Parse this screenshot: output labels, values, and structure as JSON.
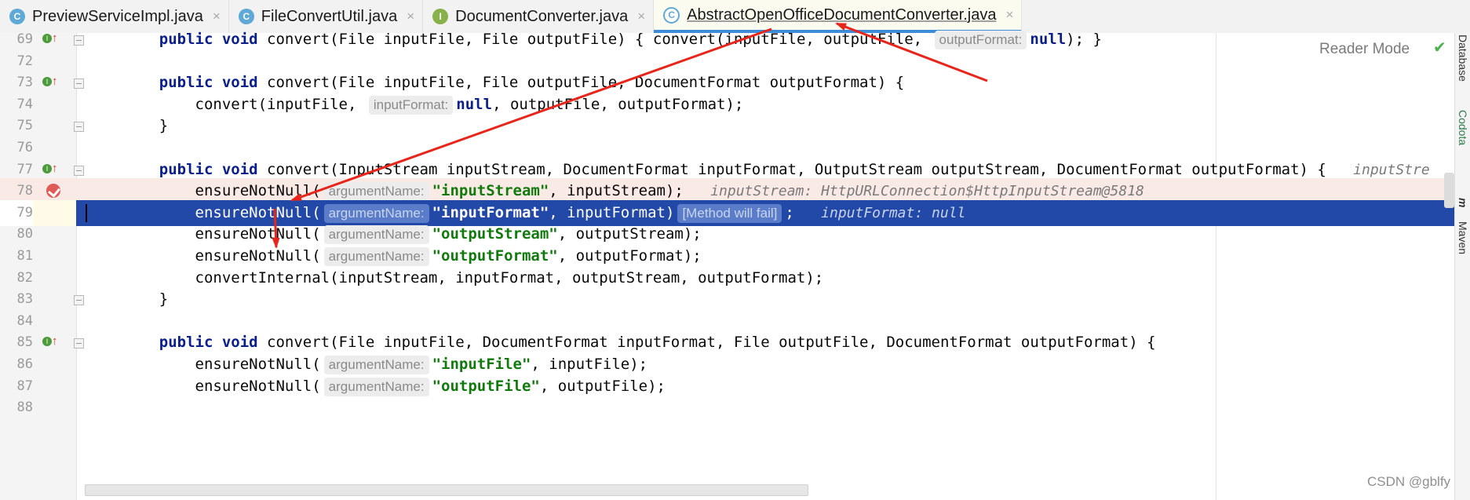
{
  "tabs": [
    {
      "icon_letter": "C",
      "icon_type": "class",
      "label": "PreviewServiceImpl.java",
      "active": false
    },
    {
      "icon_letter": "C",
      "icon_type": "class",
      "label": "FileConvertUtil.java",
      "active": false
    },
    {
      "icon_letter": "I",
      "icon_type": "interface",
      "label": "DocumentConverter.java",
      "active": false
    },
    {
      "icon_letter": "C",
      "icon_type": "abstract-class",
      "label": "AbstractOpenOfficeDocumentConverter.java",
      "active": true
    }
  ],
  "tab_close_glyph": "×",
  "reader_mode": "Reader Mode",
  "side_panels": [
    "Database",
    "Codota",
    "m",
    "Maven"
  ],
  "watermark": "CSDN @gblfy",
  "colors": {
    "arrow": "#e8251a",
    "selection": "#2248a8",
    "breakpoint": "#e05a56"
  },
  "lines": [
    {
      "n": "69",
      "marker": "impl",
      "fold": true,
      "hl": "",
      "segs": [
        [
          "    ",
          ""
        ],
        [
          "public void",
          "kw"
        ],
        [
          " convert(File inputFile, File outputFile) { convert(inputFile, outputFile, ",
          ""
        ],
        [
          "outputFormat:",
          "hint"
        ],
        [
          "null",
          "kw"
        ],
        [
          "); }",
          ""
        ]
      ]
    },
    {
      "n": "72",
      "marker": "",
      "fold": false,
      "hl": "",
      "segs": []
    },
    {
      "n": "73",
      "marker": "impl",
      "fold": true,
      "hl": "",
      "segs": [
        [
          "    ",
          ""
        ],
        [
          "public void",
          "kw"
        ],
        [
          " convert(File inputFile, File outputFile, DocumentFormat outputFormat) {",
          ""
        ]
      ]
    },
    {
      "n": "74",
      "marker": "",
      "fold": false,
      "hl": "",
      "segs": [
        [
          "        convert(inputFile, ",
          ""
        ],
        [
          "inputFormat:",
          "hint"
        ],
        [
          "null",
          "kw"
        ],
        [
          ", outputFile, outputFormat);",
          ""
        ]
      ]
    },
    {
      "n": "75",
      "marker": "",
      "fold": true,
      "hl": "",
      "segs": [
        [
          "    }",
          ""
        ]
      ]
    },
    {
      "n": "76",
      "marker": "",
      "fold": false,
      "hl": "",
      "segs": []
    },
    {
      "n": "77",
      "marker": "impl",
      "fold": true,
      "hl": "",
      "segs": [
        [
          "    ",
          ""
        ],
        [
          "public void",
          "kw"
        ],
        [
          " convert(InputStream inputStream, DocumentFormat inputFormat, OutputStream outputStream, DocumentFormat outputFormat) {   ",
          ""
        ],
        [
          "inputStre",
          "inlay"
        ]
      ]
    },
    {
      "n": "78",
      "marker": "bp",
      "fold": false,
      "hl": "pink",
      "segs": [
        [
          "        ensureNotNull(",
          ""
        ],
        [
          "argumentName:",
          "hint"
        ],
        [
          "\"inputStream\"",
          "str"
        ],
        [
          ", inputStream);   ",
          ""
        ],
        [
          "inputStream: HttpURLConnection$HttpInputStream@5818",
          "inlay"
        ]
      ]
    },
    {
      "n": "79",
      "marker": "",
      "fold": false,
      "hl": "blue",
      "segs": [
        [
          "        ensureNotNull(",
          ""
        ],
        [
          "argumentName:",
          "hint"
        ],
        [
          "\"inputFormat\"",
          "str"
        ],
        [
          ", inputFormat)",
          ""
        ],
        [
          "[Method will fail]",
          "hint"
        ],
        [
          ";   ",
          ""
        ],
        [
          "inputFormat: null",
          "inlay"
        ]
      ]
    },
    {
      "n": "80",
      "marker": "",
      "fold": false,
      "hl": "",
      "segs": [
        [
          "        ensureNotNull(",
          ""
        ],
        [
          "argumentName:",
          "hint"
        ],
        [
          "\"outputStream\"",
          "str"
        ],
        [
          ", outputStream);",
          ""
        ]
      ]
    },
    {
      "n": "81",
      "marker": "",
      "fold": false,
      "hl": "",
      "segs": [
        [
          "        ensureNotNull(",
          ""
        ],
        [
          "argumentName:",
          "hint"
        ],
        [
          "\"outputFormat\"",
          "str"
        ],
        [
          ", outputFormat);",
          ""
        ]
      ]
    },
    {
      "n": "82",
      "marker": "",
      "fold": false,
      "hl": "",
      "segs": [
        [
          "        convertInternal(inputStream, inputFormat, outputStream, outputFormat);",
          ""
        ]
      ]
    },
    {
      "n": "83",
      "marker": "",
      "fold": true,
      "hl": "",
      "segs": [
        [
          "    }",
          ""
        ]
      ]
    },
    {
      "n": "84",
      "marker": "",
      "fold": false,
      "hl": "",
      "segs": []
    },
    {
      "n": "85",
      "marker": "impl",
      "fold": true,
      "hl": "",
      "segs": [
        [
          "    ",
          ""
        ],
        [
          "public void",
          "kw"
        ],
        [
          " convert(File inputFile, DocumentFormat inputFormat, File outputFile, DocumentFormat outputFormat) {",
          ""
        ]
      ]
    },
    {
      "n": "86",
      "marker": "",
      "fold": false,
      "hl": "",
      "segs": [
        [
          "        ensureNotNull(",
          ""
        ],
        [
          "argumentName:",
          "hint"
        ],
        [
          "\"inputFile\"",
          "str"
        ],
        [
          ", inputFile);",
          ""
        ]
      ]
    },
    {
      "n": "87",
      "marker": "",
      "fold": false,
      "hl": "",
      "segs": [
        [
          "        ensureNotNull(",
          ""
        ],
        [
          "argumentName:",
          "hint"
        ],
        [
          "\"outputFile\"",
          "str"
        ],
        [
          ", outputFile);",
          ""
        ]
      ]
    },
    {
      "n": "88",
      "marker": "",
      "fold": false,
      "hl": "",
      "segs": []
    }
  ]
}
